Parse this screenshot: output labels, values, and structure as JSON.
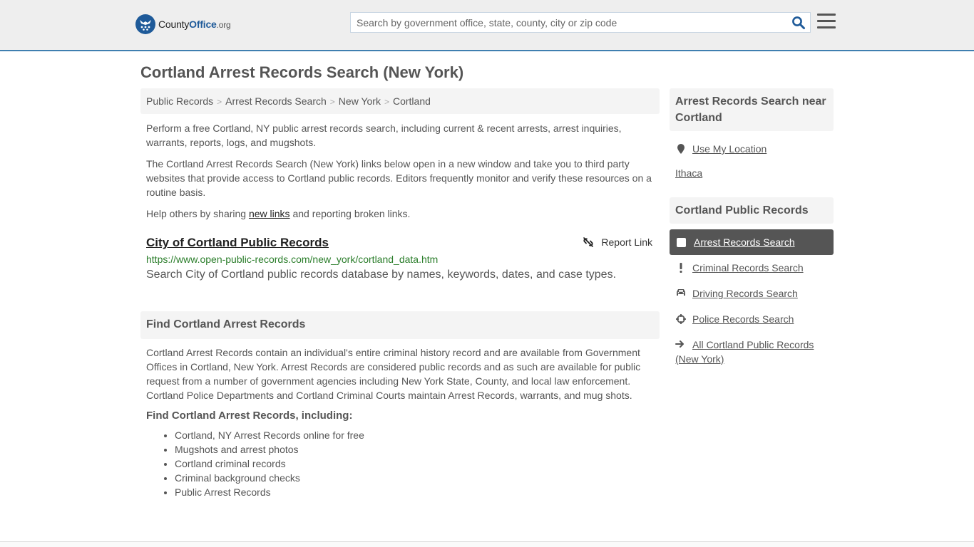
{
  "header": {
    "logo": {
      "name_part1": "County",
      "name_part2": "Office",
      "name_part3": ".org"
    },
    "search": {
      "placeholder": "Search by government office, state, county, city or zip code",
      "value": ""
    },
    "colors": {
      "accent": "#3f7fb0",
      "brand": "#1e5a99"
    }
  },
  "page": {
    "title": "Cortland Arrest Records Search (New York)"
  },
  "breadcrumb": [
    {
      "label": "Public Records"
    },
    {
      "label": "Arrest Records Search"
    },
    {
      "label": "New York"
    },
    {
      "label": "Cortland"
    }
  ],
  "breadcrumb_separator": ">",
  "intro": {
    "p1": "Perform a free Cortland, NY public arrest records search, including current & recent arrests, arrest inquiries, warrants, reports, logs, and mugshots.",
    "p2": "The Cortland Arrest Records Search (New York) links below open in a new window and take you to third party websites that provide access to Cortland public records. Editors frequently monitor and verify these resources on a routine basis.",
    "p3_before": "Help others by sharing ",
    "p3_link": "new links",
    "p3_after": " and reporting broken links."
  },
  "resource": {
    "title": "City of Cortland Public Records",
    "report_label": "Report Link",
    "url": "https://www.open-public-records.com/new_york/cortland_data.htm",
    "description": "Search City of Cortland public records database by names, keywords, dates, and case types."
  },
  "find_section": {
    "heading": "Find Cortland Arrest Records",
    "body": "Cortland Arrest Records contain an individual's entire criminal history record and are available from Government Offices in Cortland, New York. Arrest Records are considered public records and as such are available for public request from a number of government agencies including New York State, County, and local law enforcement. Cortland Police Departments and Cortland Criminal Courts maintain Arrest Records, warrants, and mug shots.",
    "subheading": "Find Cortland Arrest Records, including:",
    "items": [
      "Cortland, NY Arrest Records online for free",
      "Mugshots and arrest photos",
      "Cortland criminal records",
      "Criminal background checks",
      "Public Arrest Records"
    ]
  },
  "sidebar": {
    "near_heading": "Arrest Records Search near Cortland",
    "use_location": "Use My Location",
    "nearby": [
      "Ithaca"
    ],
    "records_heading": "Cortland Public Records",
    "nav": [
      {
        "label": "Arrest Records Search",
        "icon": "square-icon",
        "active": true
      },
      {
        "label": "Criminal Records Search",
        "icon": "exclamation-icon",
        "active": false
      },
      {
        "label": "Driving Records Search",
        "icon": "car-icon",
        "active": false
      },
      {
        "label": "Police Records Search",
        "icon": "crosshairs-icon",
        "active": false
      }
    ],
    "all_link": "All Cortland Public Records (New York)"
  }
}
